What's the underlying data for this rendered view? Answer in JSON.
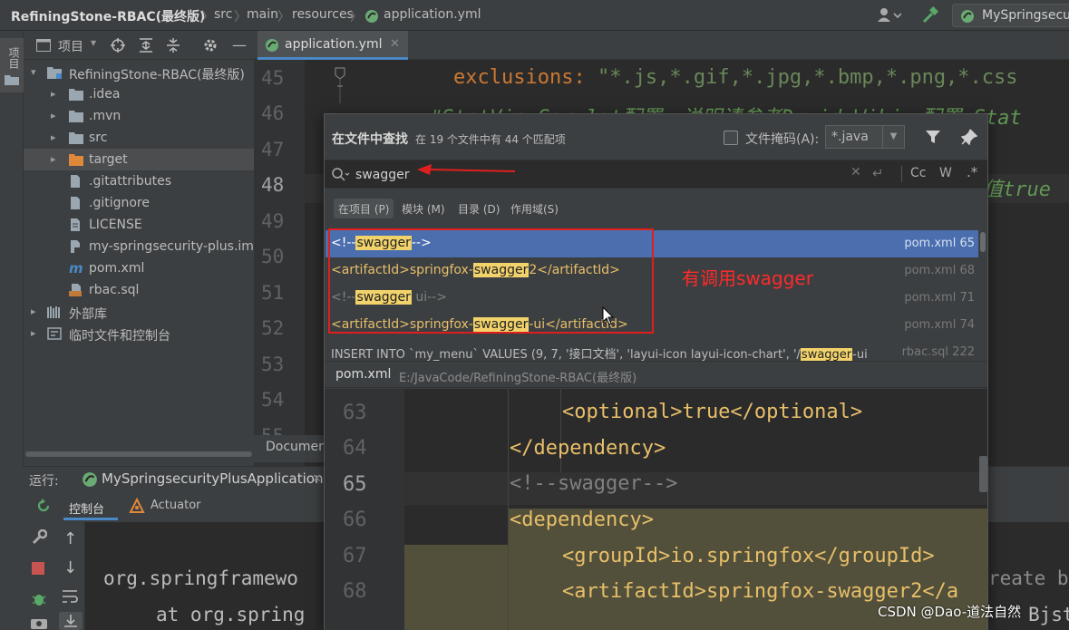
{
  "topbar": {
    "project_name": "RefiningStone-RBAC(最终版)",
    "crumbs": [
      "src",
      "main",
      "resources",
      "application.yml"
    ],
    "run_config": "MySpringsecu"
  },
  "left_strip": {
    "project_label": "项目"
  },
  "project_panel": {
    "title": "项目",
    "tree": [
      {
        "label": "RefiningStone-RBAC(最终版)",
        "kind": "module"
      },
      {
        "label": ".idea",
        "kind": "folder"
      },
      {
        "label": ".mvn",
        "kind": "folder"
      },
      {
        "label": "src",
        "kind": "folder"
      },
      {
        "label": "target",
        "kind": "folder-orange"
      },
      {
        "label": ".gitattributes",
        "kind": "file"
      },
      {
        "label": ".gitignore",
        "kind": "file"
      },
      {
        "label": "LICENSE",
        "kind": "file"
      },
      {
        "label": "my-springsecurity-plus.im",
        "kind": "file"
      },
      {
        "label": "pom.xml",
        "kind": "maven"
      },
      {
        "label": "rbac.sql",
        "kind": "sql"
      },
      {
        "label": "外部库",
        "kind": "library"
      },
      {
        "label": "临时文件和控制台",
        "kind": "scratch"
      }
    ]
  },
  "editor": {
    "tab_label": "application.yml",
    "line_numbers": [
      "45",
      "46",
      "47",
      "48",
      "49",
      "50",
      "51",
      "52",
      "53",
      "54",
      "55"
    ],
    "line45_key": "exclusions:",
    "line45_value": "\"*.js,*.gif,*.jpg,*.bmp,*.png,*.css",
    "line46_comment": "#StatViewServlet配置，说明请参考Druid Wiki，配置_Stat",
    "line48_tail": "值true",
    "doc_tab_fragment": "Documen"
  },
  "find_popup": {
    "title": "在文件中查找",
    "match_count": "在 19 个文件中有 44 个匹配项",
    "file_mask_label": "文件掩码(A):",
    "file_mask_value": "*.java",
    "search_query": "swagger",
    "opt_cc": "Cc",
    "opt_w": "W",
    "opt_regex": ".*",
    "scopes": [
      "在项目 (P)",
      "模块 (M)",
      "目录 (D)",
      "作用域(S)"
    ],
    "results": [
      {
        "pre": "<!--",
        "match": "swagger",
        "post": "-->",
        "file": "pom.xml 65"
      },
      {
        "pre": "<artifactId>springfox-",
        "match": "swagger",
        "post": "2</artifactId>",
        "file": "pom.xml 68"
      },
      {
        "pre": "<!--",
        "match": "swagger",
        "post": " ui-->",
        "file": "pom.xml 71"
      },
      {
        "pre": "<artifactId>springfox-",
        "match": "swagger",
        "post": "-ui</artifactId>",
        "file": "pom.xml 74"
      },
      {
        "pre": "INSERT INTO `my_menu` VALUES (9, 7, '接口文档', 'layui-icon layui-icon-chart', '/",
        "match": "swagger",
        "post": "-ui",
        "file": "rbac.sql 222"
      }
    ],
    "preview_file": "pom.xml",
    "preview_path": "E:/JavaCode/RefiningStone-RBAC(最终版)",
    "preview_lines": [
      {
        "n": "63",
        "text": "<optional>true</optional>"
      },
      {
        "n": "64",
        "text": "</dependency>"
      },
      {
        "n": "65",
        "text": "<!--swagger-->"
      },
      {
        "n": "66",
        "text": "<dependency>"
      },
      {
        "n": "67",
        "text": "<groupId>io.springfox</groupId>"
      },
      {
        "n": "68",
        "text": "<artifactId>springfox-swagger2</a"
      }
    ]
  },
  "run_panel": {
    "label": "运行:",
    "app_tab": "MySpringsecurityPlusApplication",
    "console_tab": "控制台",
    "actuator_tab": "Actuator",
    "console_lines": [
      "org.springframewo",
      "at org.spring"
    ],
    "right_fragment": "reate bre",
    "right_fragment2": "Bjst"
  },
  "annotation": {
    "note": "有调用swagger"
  },
  "watermark": "CSDN @Dao-道法自然",
  "colors": {
    "accent": "#4b6eaf",
    "highlight": "#f2d36b",
    "annotation": "#e01e1e"
  }
}
